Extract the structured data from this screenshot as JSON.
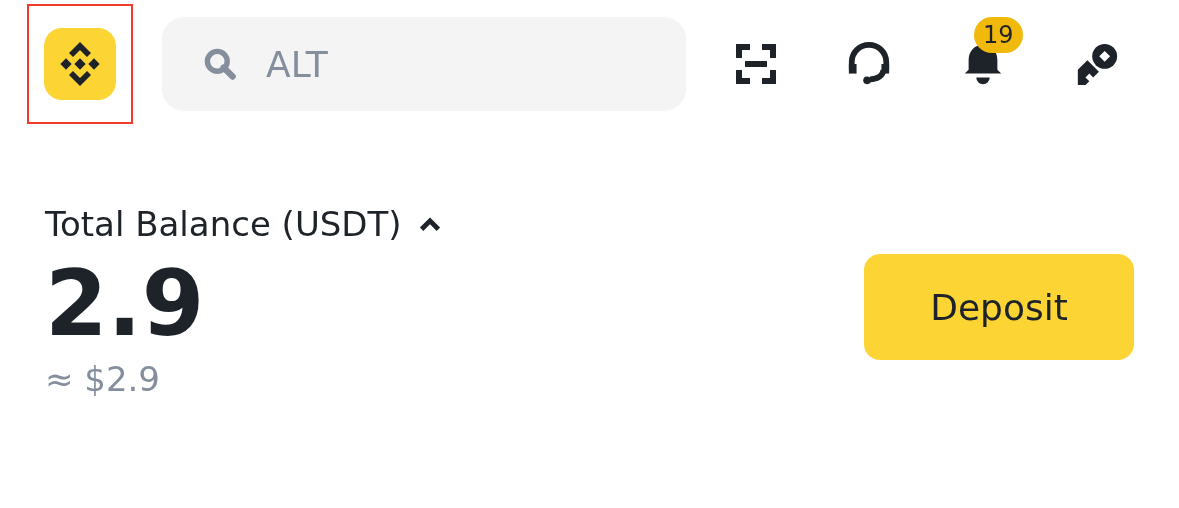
{
  "header": {
    "logo": {
      "highlighted": true
    },
    "search": {
      "placeholder": "ALT"
    },
    "notifications": {
      "badge": "19"
    }
  },
  "balance": {
    "label": "Total Balance (USDT)",
    "expanded": true,
    "amount": "2.9",
    "fiat": "≈ $2.9"
  },
  "deposit_button": "Deposit"
}
